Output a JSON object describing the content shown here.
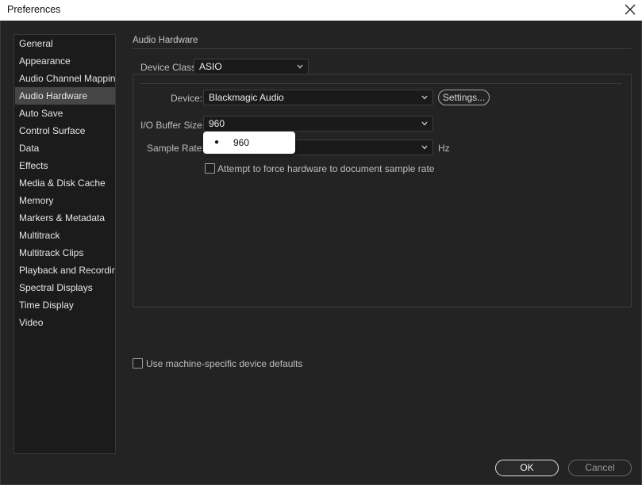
{
  "window": {
    "title": "Preferences",
    "close_icon": "close-icon"
  },
  "sidebar": {
    "selected": "Audio Hardware",
    "items": [
      {
        "label": "General"
      },
      {
        "label": "Appearance"
      },
      {
        "label": "Audio Channel Mapping"
      },
      {
        "label": "Audio Hardware"
      },
      {
        "label": "Auto Save"
      },
      {
        "label": "Control Surface"
      },
      {
        "label": "Data"
      },
      {
        "label": "Effects"
      },
      {
        "label": "Media & Disk Cache"
      },
      {
        "label": "Memory"
      },
      {
        "label": "Markers & Metadata"
      },
      {
        "label": "Multitrack"
      },
      {
        "label": "Multitrack Clips"
      },
      {
        "label": "Playback and Recording"
      },
      {
        "label": "Spectral Displays"
      },
      {
        "label": "Time Display"
      },
      {
        "label": "Video"
      }
    ]
  },
  "panel": {
    "title": "Audio Hardware",
    "device_class": {
      "label": "Device Class:",
      "value": "ASIO"
    },
    "device": {
      "label": "Device:",
      "value": "Blackmagic Audio"
    },
    "settings_button": "Settings...",
    "buffer_size": {
      "label": "I/O Buffer Size:",
      "value": "960"
    },
    "sample_rate": {
      "label": "Sample Rate:",
      "value": "",
      "unit": "Hz"
    },
    "force_rate": {
      "label": "Attempt to force hardware to document sample rate",
      "checked": false
    },
    "buffer_popup": {
      "options": [
        "960"
      ],
      "selected": "960"
    }
  },
  "machine_defaults": {
    "label": "Use machine-specific device defaults",
    "checked": false
  },
  "footer": {
    "ok": "OK",
    "cancel": "Cancel"
  },
  "colors": {
    "background": "#232323",
    "sidebar_bg": "#1b1b1b",
    "selected_bg": "#464646",
    "field_bg": "#1a1a1a"
  }
}
